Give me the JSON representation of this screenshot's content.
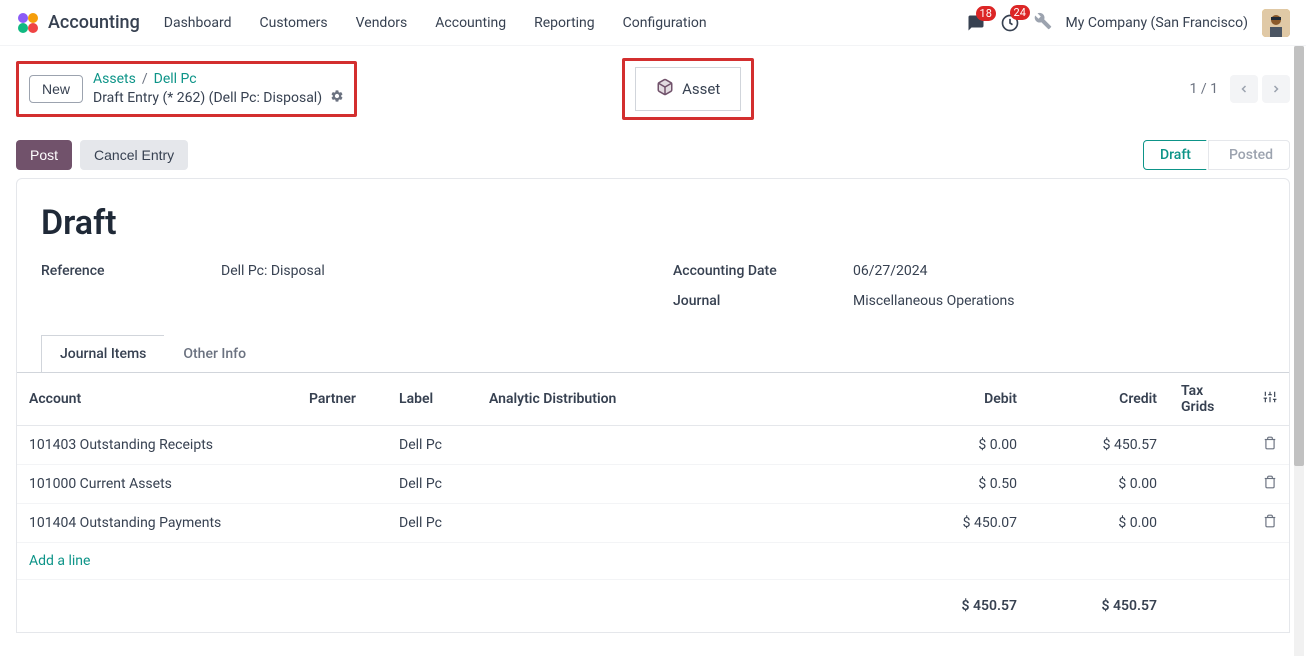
{
  "app_name": "Accounting",
  "nav": [
    "Dashboard",
    "Customers",
    "Vendors",
    "Accounting",
    "Reporting",
    "Configuration"
  ],
  "notifications": {
    "chat": "18",
    "clock": "24"
  },
  "company": "My Company (San Francisco)",
  "new_btn": "New",
  "breadcrumb": {
    "assets": "Assets",
    "item": "Dell Pc",
    "current": "Draft Entry (* 262) (Dell Pc: Disposal)"
  },
  "asset_btn": "Asset",
  "pager": "1 / 1",
  "actions": {
    "post": "Post",
    "cancel": "Cancel Entry"
  },
  "status": {
    "draft": "Draft",
    "posted": "Posted"
  },
  "title": "Draft",
  "fields": {
    "reference_label": "Reference",
    "reference_value": "Dell Pc: Disposal",
    "acct_date_label": "Accounting Date",
    "acct_date_value": "06/27/2024",
    "journal_label": "Journal",
    "journal_value": "Miscellaneous Operations"
  },
  "tabs": {
    "journal_items": "Journal Items",
    "other_info": "Other Info"
  },
  "columns": {
    "account": "Account",
    "partner": "Partner",
    "label": "Label",
    "analytic": "Analytic Distribution",
    "debit": "Debit",
    "credit": "Credit",
    "tax": "Tax Grids"
  },
  "rows": [
    {
      "account": "101403 Outstanding Receipts",
      "partner": "",
      "label": "Dell Pc",
      "debit": "$ 0.00",
      "credit": "$ 450.57"
    },
    {
      "account": "101000 Current Assets",
      "partner": "",
      "label": "Dell Pc",
      "debit": "$ 0.50",
      "credit": "$ 0.00"
    },
    {
      "account": "101404 Outstanding Payments",
      "partner": "",
      "label": "Dell Pc",
      "debit": "$ 450.07",
      "credit": "$ 0.00"
    }
  ],
  "add_line": "Add a line",
  "totals": {
    "debit": "$ 450.57",
    "credit": "$ 450.57"
  }
}
